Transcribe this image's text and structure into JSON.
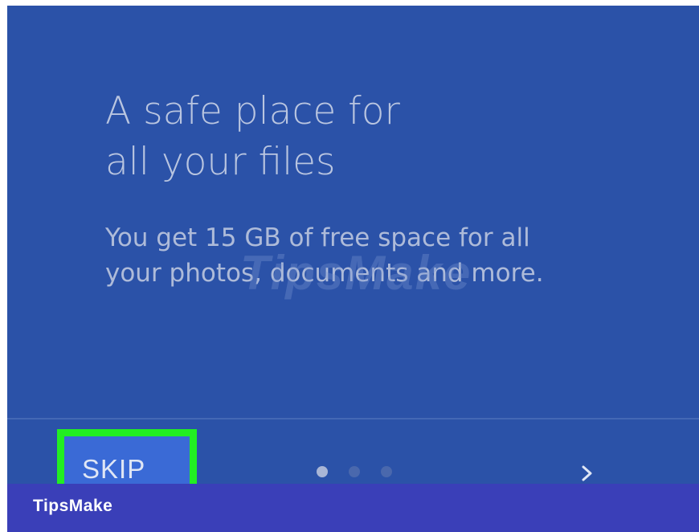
{
  "onboarding": {
    "headline_line1": "A safe place for",
    "headline_line2": "all your files",
    "body_line1": "You get 15 GB of free space for all",
    "body_line2": "your photos, documents and more."
  },
  "footer": {
    "skip_label": "SKIP",
    "page_indicator": {
      "total": 3,
      "current": 1
    },
    "next_icon": "chevron-right-icon"
  },
  "watermark": {
    "text": "TipsMake"
  },
  "branding": {
    "label": "TipsMake"
  },
  "colors": {
    "screen_background": "#2b52a8",
    "highlight_border": "#22ee22",
    "brand_bar": "#3a3fb8"
  }
}
